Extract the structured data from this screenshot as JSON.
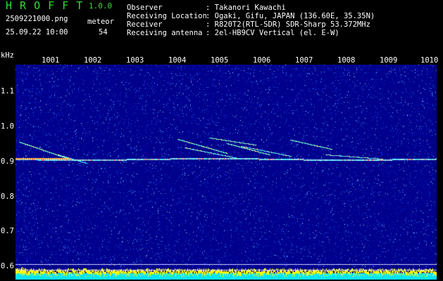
{
  "app": {
    "name": "H R O F F T",
    "version": "1.0.0"
  },
  "file": {
    "name": "2509221000.png",
    "datetime": "25.09.22 10:00"
  },
  "counter": {
    "label": "meteor",
    "value": "54"
  },
  "info": [
    {
      "key": "Observer",
      "value": ": Takanori Kawachi"
    },
    {
      "key": "Receiving Location",
      "value": ": Ogaki, Gifu, JAPAN (136.60E, 35.35N)"
    },
    {
      "key": "Receiver",
      "value": ": R820T2(RTL-SDR) SDR-Sharp 53.372MHz"
    },
    {
      "key": "Receiving antenna",
      "value": ": 2el-HB9CV Vertical (el. E-W)"
    }
  ],
  "axis": {
    "y_unit": "kHz",
    "y_ticks": [
      "1.1",
      "1.0",
      "0.9",
      "0.8",
      "0.7",
      "0.6"
    ],
    "x_ticks": [
      "1001",
      "1002",
      "1003",
      "1004",
      "1005",
      "1006",
      "1007",
      "1008",
      "1009",
      "1010"
    ]
  },
  "colors": {
    "background": "#000000",
    "text": "#ffffff",
    "title_green": "#33dd33",
    "spectrogram_base": "#00008c",
    "meteor_trace": "#66ffcc",
    "signal_bar": "#ffff00",
    "signal_base": "#00e5ff"
  }
}
